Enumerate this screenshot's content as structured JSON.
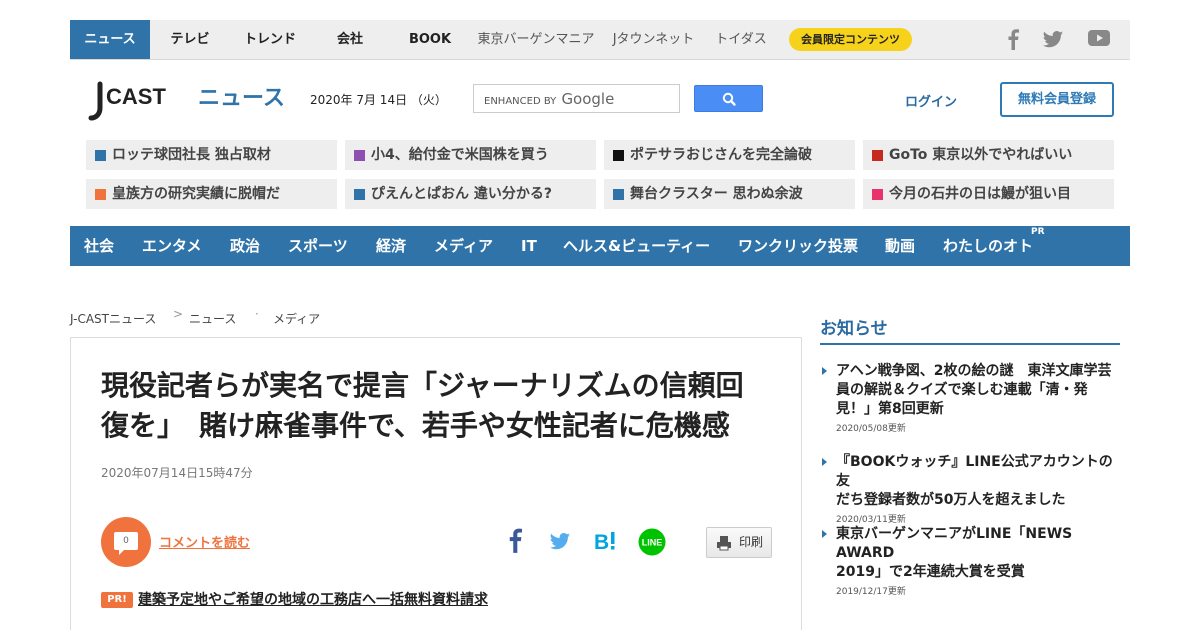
{
  "top_nav": {
    "items": [
      "ニュース",
      "テレビ",
      "トレンド",
      "会社",
      "BOOK",
      "東京バーゲンマニア",
      "Jタウンネット",
      "トイダス"
    ],
    "member_button": "会員限定コンテンツ",
    "active_color": "#2f73a8",
    "member_color": "#f7d21a",
    "sns_icons": [
      "facebook-icon",
      "twitter-icon",
      "youtube-icon"
    ]
  },
  "header": {
    "logo_text_left": "CAST",
    "logo_text_right": "ニュース",
    "date": "2020年 7月 14日 （火）",
    "search_prefix": "ENHANCED BY",
    "search_brand": "Google",
    "login": "ログイン",
    "register": "無料会員登録"
  },
  "trending": [
    {
      "label": "ロッテ球団社長 独占取材",
      "color": "#2f73a8"
    },
    {
      "label": "小4、給付金で米国株を買う",
      "color": "#8e4fb3"
    },
    {
      "label": "ポテサラおじさんを完全論破",
      "color": "#111111"
    },
    {
      "label": "GoTo 東京以外でやればいい",
      "color": "#c62a1f"
    },
    {
      "label": "皇族方の研究実績に脱帽だ",
      "color": "#f0733e"
    },
    {
      "label": "ぴえんとぱおん 違い分かる?",
      "color": "#2f73a8"
    },
    {
      "label": "舞台クラスター 思わぬ余波",
      "color": "#2f73a8"
    },
    {
      "label": "今月の石井の日は鰻が狙い目",
      "color": "#e8336d"
    }
  ],
  "category_nav": {
    "items": [
      "社会",
      "エンタメ",
      "政治",
      "スポーツ",
      "経済",
      "メディア",
      "IT",
      "ヘルス&ビューティー",
      "ワンクリック投票",
      "動画",
      "わたしのオト"
    ],
    "pr": "PR"
  },
  "breadcrumb": [
    "J-CASTニュース",
    "ニュース",
    "メディア"
  ],
  "article": {
    "title_line1": "現役記者らが実名で提言「ジャーナリズムの信頼回",
    "title_line2": "復を」　賭け麻雀事件で、若手や女性記者に危機感",
    "date": "2020年07月14日15時47分",
    "comment_count": "0",
    "comment_link": "コメントを読む",
    "share_icons": [
      "facebook-icon",
      "twitter-icon",
      "hatena-icon",
      "line-icon"
    ],
    "print": "印刷",
    "pr_badge": "PR!",
    "pr_link": "建築予定地やご希望の地域の工務店へ一括無料資料請求"
  },
  "sidebar": {
    "title": "お知らせ",
    "items": [
      {
        "l1": "アヘン戦争図、2枚の絵の謎　東洋文庫学芸",
        "l2": "員の解説＆クイズで楽しむ連載「清・発",
        "l3": "見！」第8回更新",
        "date": "2020/05/08更新"
      },
      {
        "l1": "『BOOKウォッチ』LINE公式アカウントの友",
        "l2": "だち登録者数が50万人を超えました",
        "date": "2020/03/11更新"
      },
      {
        "l1": "東京バーゲンマニアがLINE「NEWS AWARD",
        "l2": "2019」で2年連続大賞を受賞",
        "date": "2019/12/17更新"
      }
    ]
  }
}
